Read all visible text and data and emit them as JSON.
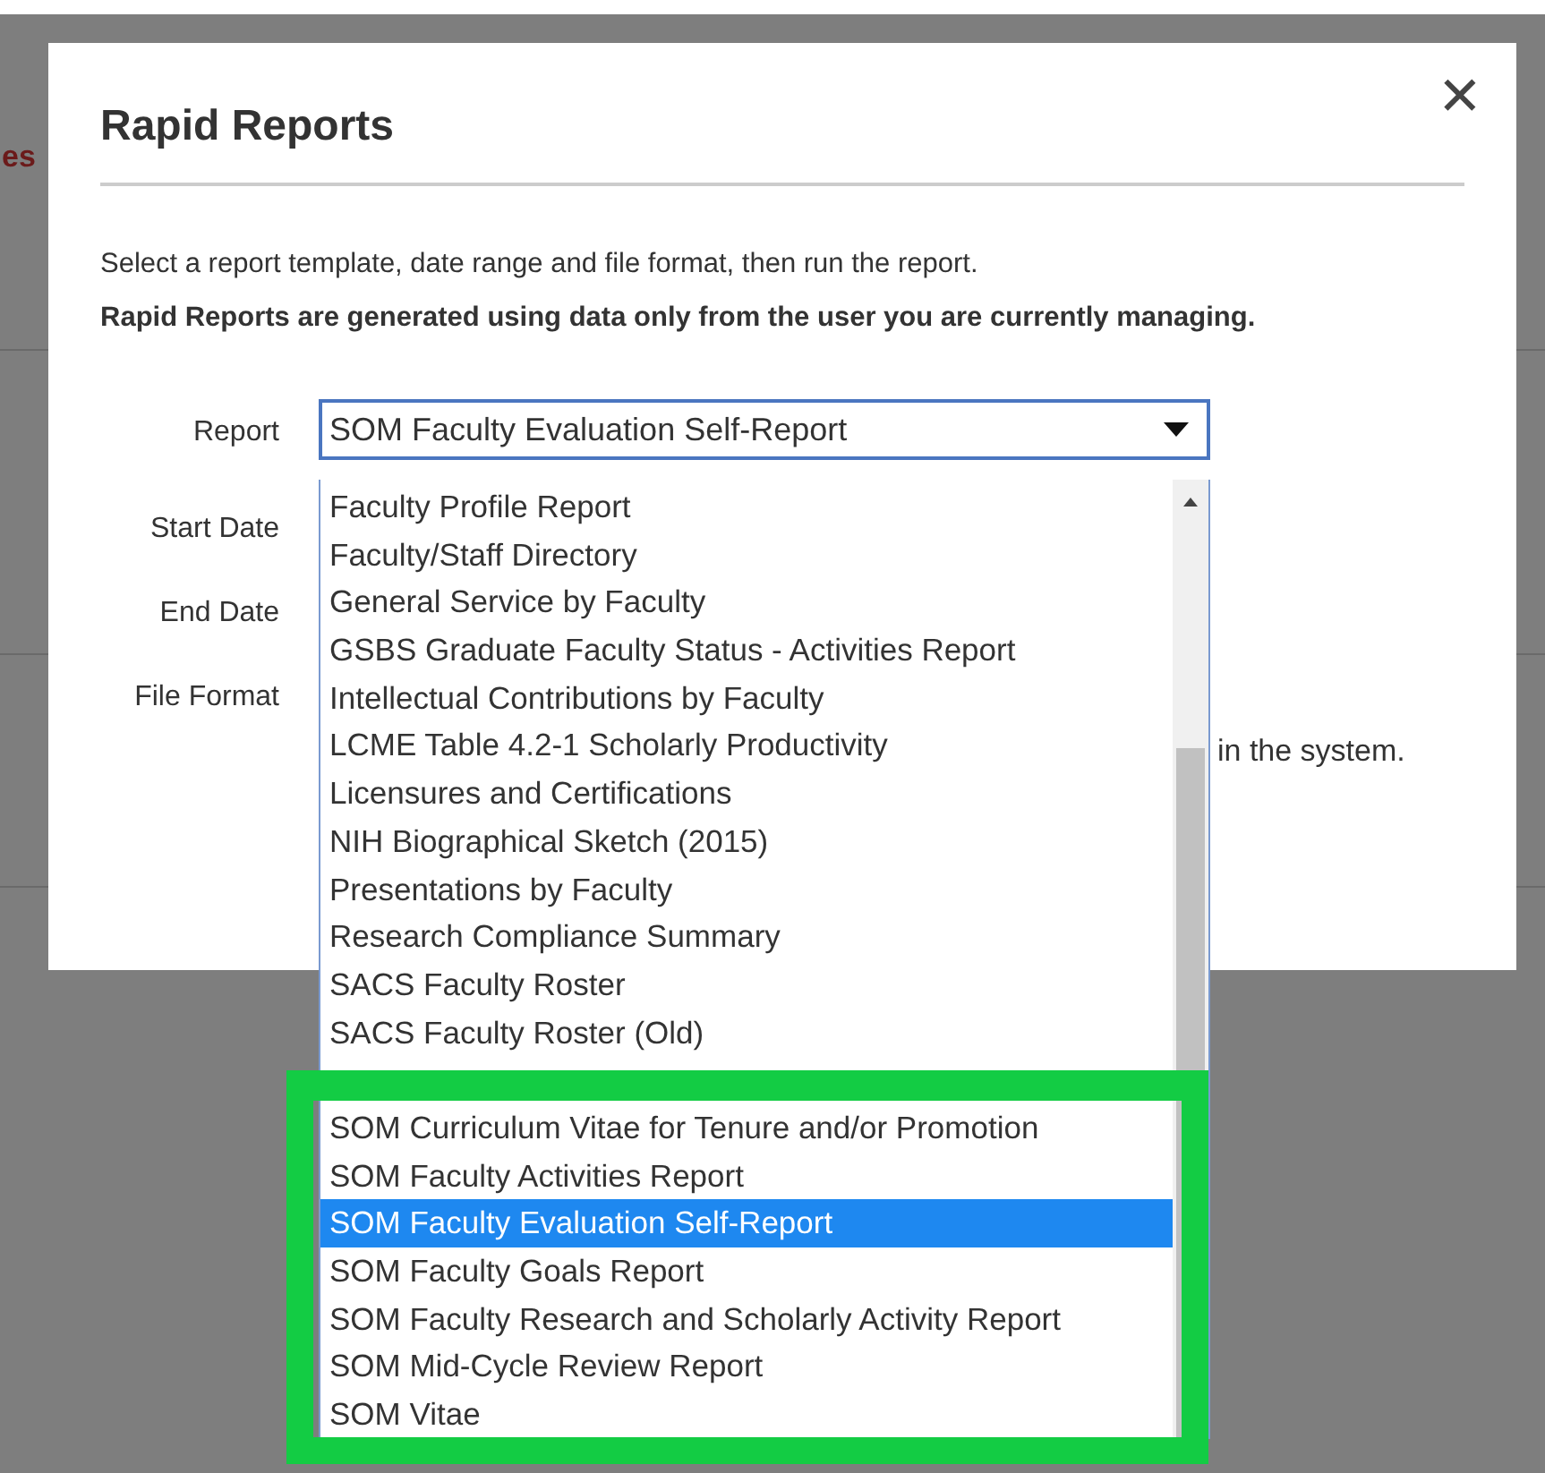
{
  "background": {
    "fragment": "es",
    "note": "in the system."
  },
  "dialog": {
    "title": "Rapid Reports",
    "close": "✕",
    "intro": "Select a report template, date range and file format, then run the report.",
    "notice": "Rapid Reports are generated using data only from the user you are currently managing.",
    "fields": [
      {
        "label": "Report"
      },
      {
        "label": "Start Date"
      },
      {
        "label": "End Date"
      },
      {
        "label": "File Format"
      }
    ],
    "report_value": "SOM Faculty Evaluation Self-Report"
  },
  "dropdown": {
    "options": [
      {
        "label": "Faculty Profile Report",
        "selected": false
      },
      {
        "label": "Faculty/Staff Directory",
        "selected": false
      },
      {
        "label": "General Service by Faculty",
        "selected": false
      },
      {
        "label": "GSBS Graduate Faculty Status - Activities Report",
        "selected": false
      },
      {
        "label": "Intellectual Contributions by Faculty",
        "selected": false
      },
      {
        "label": "LCME Table 4.2-1 Scholarly Productivity",
        "selected": false
      },
      {
        "label": "Licensures and Certifications",
        "selected": false
      },
      {
        "label": "NIH Biographical Sketch (2015)",
        "selected": false
      },
      {
        "label": "Presentations by Faculty",
        "selected": false
      },
      {
        "label": "Research Compliance Summary",
        "selected": false
      },
      {
        "label": "SACS Faculty Roster",
        "selected": false
      },
      {
        "label": "SACS Faculty Roster (Old)",
        "selected": false
      }
    ],
    "highlighted_options": [
      {
        "label": "SOM Curriculum Vitae for Tenure and/or Promotion",
        "selected": false
      },
      {
        "label": "SOM Faculty Activities Report",
        "selected": false
      },
      {
        "label": "SOM Faculty Evaluation Self-Report",
        "selected": true
      },
      {
        "label": "SOM Faculty Goals Report",
        "selected": false
      },
      {
        "label": "SOM Faculty Research and Scholarly Activity Report",
        "selected": false
      },
      {
        "label": "SOM Mid-Cycle Review Report",
        "selected": false
      },
      {
        "label": "SOM Vitae",
        "selected": false
      }
    ]
  }
}
